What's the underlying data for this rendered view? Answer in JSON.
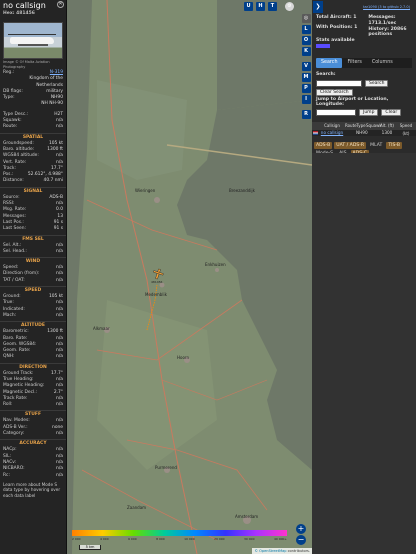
{
  "info": {
    "callsign": "no callsign",
    "hex_label": "Hex:",
    "hex": "481456",
    "photo_credit": "Image © Of Malta Aviation Photography",
    "details": [
      {
        "k": "Reg.:",
        "v": "N-319",
        "link": true
      },
      {
        "k": "",
        "v": "Kingdom of the Netherlands",
        "link": false
      },
      {
        "k": "DB flags:",
        "v": "military",
        "link": false
      },
      {
        "k": "Type:",
        "v": "NH90",
        "link": false
      },
      {
        "k": "",
        "v": "NH NH-90",
        "link": false
      }
    ],
    "details2": [
      {
        "k": "Type Desc.:",
        "v": "H2T"
      },
      {
        "k": "Squawk:",
        "v": "n/a"
      },
      {
        "k": "Route:",
        "v": "n/a"
      }
    ],
    "sections": [
      {
        "title": "SPATIAL",
        "rows": [
          {
            "k": "Groundspeed:",
            "v": "105 kt"
          },
          {
            "k": "Baro. altitude:",
            "v": "1300 ft"
          },
          {
            "k": "WGS84 altitude:",
            "v": "n/a"
          },
          {
            "k": "Vert. Rate:",
            "v": "n/a"
          },
          {
            "k": "Track:",
            "v": "17.7°"
          },
          {
            "k": "Pos.:",
            "v": "52.612°, 4.988°"
          },
          {
            "k": "Distance:",
            "v": "40.7 nmi"
          }
        ]
      },
      {
        "title": "SIGNAL",
        "rows": [
          {
            "k": "Source:",
            "v": "ADS-B"
          },
          {
            "k": "RSSI:",
            "v": "n/a"
          },
          {
            "k": "Msg. Rate:",
            "v": "0.0"
          },
          {
            "k": "Messages:",
            "v": "13"
          },
          {
            "k": "",
            "v": ""
          },
          {
            "k": "Last Pos.:",
            "v": "91 s"
          },
          {
            "k": "Last Seen:",
            "v": "91 s"
          }
        ]
      },
      {
        "title": "FMS SEL",
        "rows": [
          {
            "k": "Sel. Alt.:",
            "v": "n/a"
          },
          {
            "k": "Sel. Head.:",
            "v": "n/a"
          }
        ]
      },
      {
        "title": "WIND",
        "rows": [
          {
            "k": "Speed:",
            "v": "n/a"
          },
          {
            "k": "Direction (from):",
            "v": "n/a"
          },
          {
            "k": "TAT / OAT:",
            "v": "n/a"
          }
        ]
      },
      {
        "title": "SPEED",
        "rows": [
          {
            "k": "Ground:",
            "v": "105 kt"
          },
          {
            "k": "True:",
            "v": "n/a"
          },
          {
            "k": "Indicated:",
            "v": "n/a"
          },
          {
            "k": "Mach:",
            "v": "n/a"
          }
        ]
      },
      {
        "title": "ALTITUDE",
        "rows": [
          {
            "k": "Barometric:",
            "v": "1300 ft"
          },
          {
            "k": "Baro. Rate:",
            "v": "n/a"
          },
          {
            "k": "Geom. WGS84:",
            "v": "n/a"
          },
          {
            "k": "Geom. Rate:",
            "v": "n/a"
          },
          {
            "k": "QNH:",
            "v": "n/a"
          }
        ]
      },
      {
        "title": "DIRECTION",
        "rows": [
          {
            "k": "Ground Track:",
            "v": "17.7°"
          },
          {
            "k": "True Heading:",
            "v": "n/a"
          },
          {
            "k": "Magnetic Heading:",
            "v": "n/a"
          },
          {
            "k": "Magnetic Decl.:",
            "v": "2.7°"
          },
          {
            "k": "Track Rate:",
            "v": "n/a"
          },
          {
            "k": "Roll:",
            "v": "n/a"
          }
        ]
      },
      {
        "title": "STUFF",
        "rows": [
          {
            "k": "Nav. Modes:",
            "v": "n/a"
          },
          {
            "k": "ADS-B Ver.:",
            "v": "none"
          },
          {
            "k": "Category:",
            "v": "n/a"
          }
        ]
      },
      {
        "title": "ACCURACY",
        "rows": [
          {
            "k": "NACp:",
            "v": "n/a"
          },
          {
            "k": "SIL:",
            "v": "n/a"
          },
          {
            "k": "NACv:",
            "v": "n/a"
          },
          {
            "k": "NICBARO:",
            "v": "n/a"
          },
          {
            "k": "Rc:",
            "v": "n/a"
          }
        ]
      }
    ],
    "footnote": "Learn more about Mode S data type by hovering over each data label"
  },
  "map": {
    "buttons_top": [
      "U",
      "H",
      "T"
    ],
    "toggles": [
      "L",
      "O",
      "K",
      "V",
      "M",
      "P",
      "I",
      "R"
    ],
    "labels": [
      "Wieringen",
      "Breezanddijk",
      "Medemblik",
      "Enkhuizen",
      "Hoorn",
      "Alkmaar",
      "Purmerend",
      "Zaandam",
      "Amsterdam"
    ],
    "colorbar_ticks": [
      "2 000",
      "4 000",
      "6 000",
      "8 000",
      "10 000",
      "20 000",
      "30 000",
      "40 000+"
    ],
    "scale": "5 km",
    "aircraft_label": "481456",
    "attribution_link": "© OpenStreetMap",
    "attribution_text": "contributors."
  },
  "panel": {
    "version": "tar1090 (3 to github 2.7.0)",
    "stats": {
      "total_label": "Total Aircraft: 1",
      "position_label": "With Position: 1",
      "messages_label": "Messages:",
      "messages_value": "1713.1/sec",
      "history_label": "History: 20866",
      "history_value": "positions",
      "available_label": "Stats available"
    },
    "tabs": [
      "Search",
      "Filters",
      "Columns"
    ],
    "search_label": "Search:",
    "search_button": "Search",
    "clear_search": "Clear Search",
    "jump_label": "Jump to Airport or Location, Longitude:",
    "jump_button": "Jump",
    "clear_button": "Clear",
    "columns": [
      "",
      "Callsign",
      "Route",
      "Type",
      "Squawk",
      "Alt. (ft)",
      "Speed (kt)"
    ],
    "row": {
      "callsign": "no callsign",
      "route": "",
      "type": "NH90",
      "squawk": "",
      "alt": "1300",
      "speed": ""
    },
    "badges": [
      {
        "label": "ADS-B",
        "on": true
      },
      {
        "label": "UAT / ADS-R",
        "on": true
      },
      {
        "label": "MLAT",
        "on": false
      },
      {
        "label": "TIS-B",
        "on": true
      },
      {
        "label": "Mode-S",
        "on": false
      },
      {
        "label": "AIS",
        "on": false
      },
      {
        "label": "ADS-C",
        "on": true
      }
    ]
  }
}
